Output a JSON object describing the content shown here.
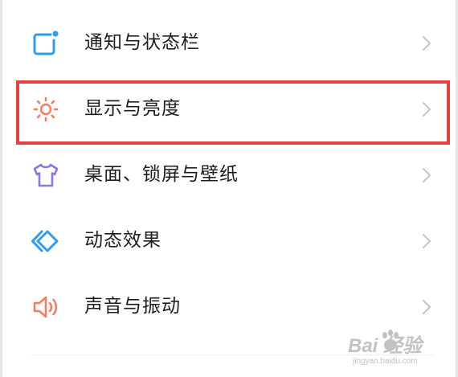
{
  "settings": {
    "items": [
      {
        "label": "通知与状态栏",
        "icon": "notification-icon",
        "icon_color": "#2f9cf2"
      },
      {
        "label": "显示与亮度",
        "icon": "brightness-icon",
        "icon_color": "#f07f5f"
      },
      {
        "label": "桌面、锁屏与壁纸",
        "icon": "tshirt-icon",
        "icon_color": "#8f73de"
      },
      {
        "label": "动态效果",
        "icon": "diamond-icon",
        "icon_color": "#2f9cf2"
      },
      {
        "label": "声音与振动",
        "icon": "speaker-icon",
        "icon_color": "#f07f5f"
      }
    ],
    "chevron_color": "#c4c4c4",
    "highlight_color": "#e8413f"
  },
  "watermark": {
    "main": "Bai  经验",
    "sub": "jingyan.baidu.com"
  }
}
